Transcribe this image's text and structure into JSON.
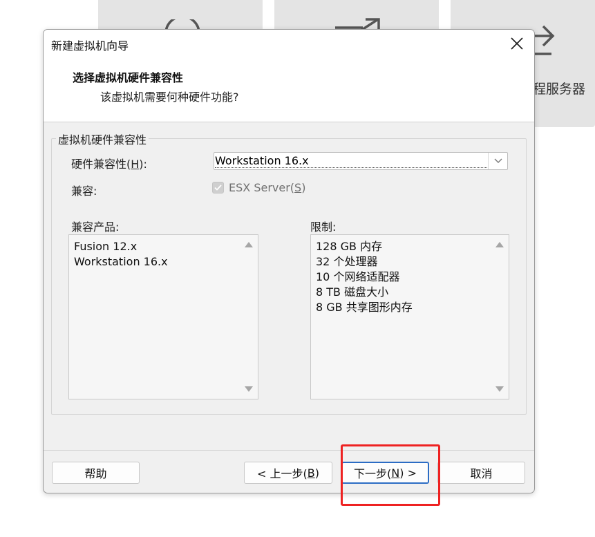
{
  "background_tiles": {
    "tile3_label": "程服务器"
  },
  "dialog": {
    "title": "新建虚拟机向导",
    "heading": "选择虚拟机硬件兼容性",
    "subheading": "该虚拟机需要何种硬件功能?",
    "group_title": "虚拟机硬件兼容性",
    "hw_compat": {
      "label": "硬件兼容性(",
      "hotkey": "H",
      "label_suffix": "):",
      "value": "Workstation 16.x"
    },
    "compat": {
      "label": "兼容:",
      "checkbox_label": "ESX Server(",
      "checkbox_hotkey": "S",
      "checkbox_suffix": ")",
      "checked": true,
      "disabled": true
    },
    "products": {
      "label": "兼容产品:",
      "items": [
        "Fusion 12.x",
        "Workstation 16.x"
      ]
    },
    "limits": {
      "label": "限制:",
      "items": [
        "128 GB 内存",
        "32 个处理器",
        "10 个网络适配器",
        "8 TB 磁盘大小",
        "8 GB 共享图形内存"
      ]
    },
    "buttons": {
      "help": "帮助",
      "back_prefix": "< 上一步(",
      "back_hotkey": "B",
      "back_suffix": ")",
      "next_prefix": "下一步(",
      "next_hotkey": "N",
      "next_suffix": ") >",
      "cancel": "取消"
    }
  },
  "annotation": {
    "highlight_color": "#ee2222",
    "target": "next-button"
  },
  "colors": {
    "accent": "#2b6cc4",
    "dialog_bg": "#f0f0f0"
  }
}
